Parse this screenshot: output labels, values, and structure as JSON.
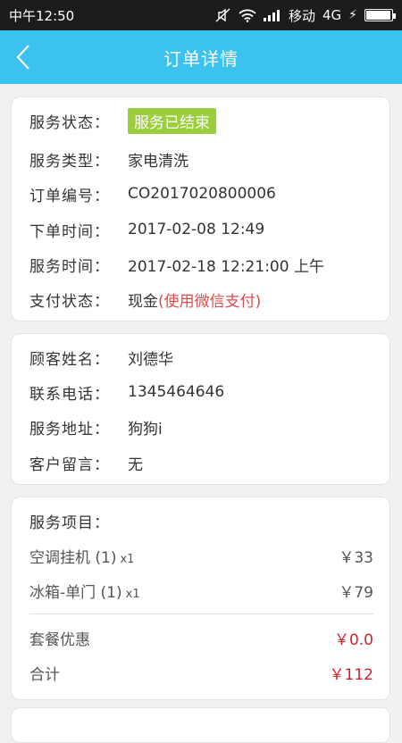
{
  "status_bar": {
    "time": "中午12:50",
    "carrier": "移动",
    "network": "4G",
    "icons": [
      "mute-icon",
      "wifi-icon",
      "signal-icon",
      "charging-icon",
      "battery-icon"
    ]
  },
  "header": {
    "title": "订单详情",
    "back_icon": "chevron-left-icon",
    "color": "#3cc2ef"
  },
  "order": {
    "status_label": "服务状态：",
    "status_value": "服务已结束",
    "type_label": "服务类型：",
    "type_value": "家电清洗",
    "number_label": "订单编号：",
    "number_value": "CO2017020800006",
    "order_time_label": "下单时间：",
    "order_time_value": "2017-02-08 12:49",
    "service_time_label": "服务时间：",
    "service_time_value": "2017-02-18 12:21:00 上午",
    "payment_label": "支付状态：",
    "payment_value": "现金",
    "payment_note": "(使用微信支付)"
  },
  "customer": {
    "name_label": "顾客姓名：",
    "name_value": "刘德华",
    "phone_label": "联系电话：",
    "phone_value": "1345464646",
    "address_label": "服务地址：",
    "address_value": "狗狗i",
    "note_label": "客户留言：",
    "note_value": "无"
  },
  "items": {
    "title": "服务项目：",
    "list": [
      {
        "name": "空调挂机 (1)",
        "qty": "x1",
        "price": "￥33"
      },
      {
        "name": "冰箱-单门 (1)",
        "qty": "x1",
        "price": "￥79"
      }
    ],
    "discount_label": "套餐优惠",
    "discount_value": "￥0.0",
    "total_label": "合计",
    "total_value": "￥112"
  }
}
